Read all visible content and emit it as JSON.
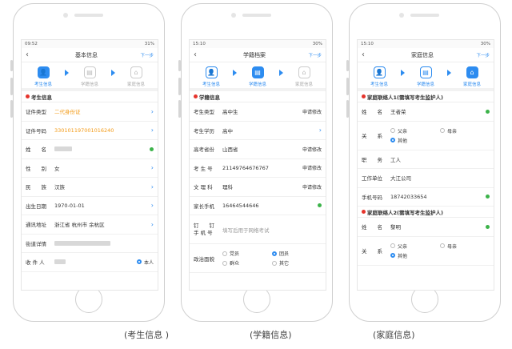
{
  "phones": [
    {
      "status": {
        "time": "09:52",
        "battery": "31%"
      },
      "title": "基本信息",
      "next": "下一步",
      "steps": [
        {
          "label": "考生信息",
          "icon": "person-icon",
          "state": "active"
        },
        {
          "label": "学籍信息",
          "icon": "document-icon",
          "state": "inactive"
        },
        {
          "label": "家庭信息",
          "icon": "home-icon",
          "state": "inactive"
        }
      ],
      "section": "考生信息",
      "rows": [
        {
          "label": "证件类型",
          "value": "二代身份证",
          "style": "orange",
          "right": "chevron"
        },
        {
          "label": "证件号码",
          "value": "330101197001016240",
          "style": "orange",
          "right": "chevron"
        },
        {
          "label": "姓　　名",
          "value": "",
          "blur": 22,
          "right": "dot"
        },
        {
          "label": "性　　别",
          "value": "女",
          "right": "chevron"
        },
        {
          "label": "民　　族",
          "value": "汉族",
          "right": "chevron"
        },
        {
          "label": "出生日期",
          "value": "1970-01-01",
          "right": "chevron"
        },
        {
          "label": "通讯地址",
          "value": "浙江省 杭州市 余杭区",
          "right": "chevron"
        },
        {
          "label": "街道详情",
          "value": "",
          "blur": 70,
          "right": ""
        },
        {
          "label": "收 件 人",
          "value": "",
          "blur": 14,
          "right": "radio",
          "radio_label": "本人"
        }
      ]
    },
    {
      "status": {
        "time": "15:10",
        "battery": "30%"
      },
      "title": "学籍档案",
      "next": "下一步",
      "steps": [
        {
          "label": "考生信息",
          "icon": "person-icon",
          "state": "done"
        },
        {
          "label": "学籍信息",
          "icon": "document-icon",
          "state": "active"
        },
        {
          "label": "家庭信息",
          "icon": "home-icon",
          "state": "inactive"
        }
      ],
      "section": "学籍信息",
      "rows": [
        {
          "label": "考生类型",
          "value": "高中生",
          "right": "action",
          "action": "申请修改"
        },
        {
          "label": "考生学历",
          "value": "高中",
          "right": "chevron"
        },
        {
          "label": "高考省份",
          "value": "山西省",
          "right": "action",
          "action": "申请修改"
        },
        {
          "label": "考 生 号",
          "value": "21149764676767",
          "right": "action",
          "action": "申请修改"
        },
        {
          "label": "文 理 科",
          "value": "理科",
          "right": "action",
          "action": "申请修改"
        },
        {
          "label": "家长手机",
          "value": "16464544646",
          "right": "dot"
        },
        {
          "label": "钉　　钉\n手 机 号",
          "value": "填写后用于网络考试",
          "style": "gray",
          "right": "",
          "tall": true
        },
        {
          "label": "政治面貌",
          "value": "",
          "right": "",
          "tall": true,
          "radios": [
            {
              "label": "党员",
              "on": false
            },
            {
              "label": "团员",
              "on": true
            },
            {
              "label": "群众",
              "on": false
            },
            {
              "label": "其它",
              "on": false
            }
          ]
        }
      ]
    },
    {
      "status": {
        "time": "15:10",
        "battery": "30%"
      },
      "title": "家庭信息",
      "next": "下一步",
      "steps": [
        {
          "label": "考生信息",
          "icon": "person-icon",
          "state": "done"
        },
        {
          "label": "学籍信息",
          "icon": "document-icon",
          "state": "done"
        },
        {
          "label": "家庭信息",
          "icon": "home-icon",
          "state": "active"
        }
      ],
      "section": "家庭联络人1(需填写考生监护人)",
      "rows": [
        {
          "label": "姓　　名",
          "value": "王者荣",
          "right": "dot"
        },
        {
          "label": "关　　系",
          "value": "",
          "right": "",
          "tall": true,
          "radios": [
            {
              "label": "父亲",
              "on": false
            },
            {
              "label": "母亲",
              "on": false
            },
            {
              "label": "其他",
              "on": true
            }
          ]
        },
        {
          "label": "职　　务",
          "value": "工人",
          "right": ""
        },
        {
          "label": "工作单位",
          "value": "大江公司",
          "right": ""
        },
        {
          "label": "手机号码",
          "value": "18742033654",
          "right": "dot"
        }
      ],
      "section2": "家庭联络人2(需填写考生监护人)",
      "rows2": [
        {
          "label": "姓　　名",
          "value": "黎明",
          "right": "dot"
        },
        {
          "label": "关　　系",
          "value": "",
          "right": "",
          "tall": true,
          "radios": [
            {
              "label": "父亲",
              "on": false
            },
            {
              "label": "母亲",
              "on": false
            },
            {
              "label": "其他",
              "on": true
            }
          ]
        }
      ]
    }
  ],
  "captions": [
    "(考生信息 )",
    "(学籍信息)",
    "(家庭信息)"
  ],
  "colors": {
    "accent": "#2d8cf0",
    "required": "#e6342c",
    "highlight": "#f39a16",
    "ok": "#3cb34a"
  }
}
